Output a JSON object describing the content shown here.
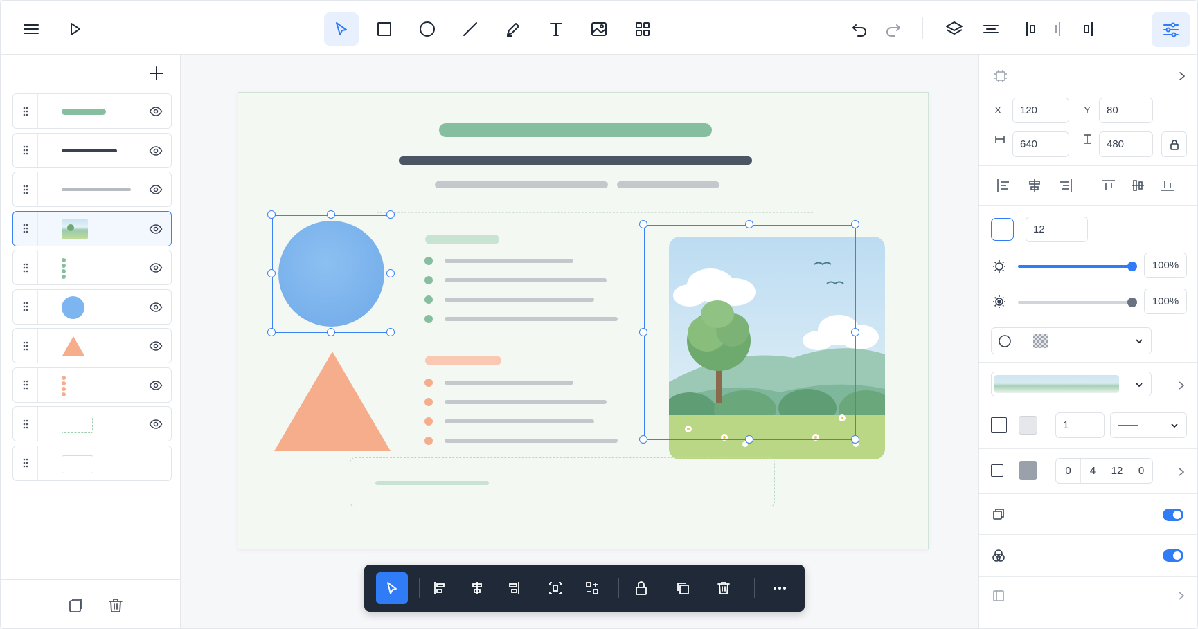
{
  "toolbar": {
    "left_tools": [
      "menu-icon",
      "play-icon"
    ],
    "tools": [
      "select-tool",
      "rectangle-tool",
      "ellipse-tool",
      "line-tool",
      "pen-tool",
      "text-tool",
      "image-tool",
      "components-tool"
    ],
    "active_tool": "select-tool",
    "right_tools": [
      "undo",
      "redo",
      "layers",
      "distribute",
      "align-left-edge",
      "align-center-v",
      "align-right-edge",
      "properties"
    ]
  },
  "layers": [
    {
      "name": "title-bar-green",
      "kind": "bar",
      "color": "#86bfa0",
      "visible": true
    },
    {
      "name": "heading-bar-dark",
      "kind": "bar",
      "color": "#374151",
      "visible": true
    },
    {
      "name": "subtitle-bar-gray",
      "kind": "bar",
      "color": "#b8bcc2",
      "visible": true
    },
    {
      "name": "landscape-image",
      "kind": "image",
      "visible": true,
      "selected": true
    },
    {
      "name": "green-bullet-list",
      "kind": "dots",
      "color": "#86bfa0",
      "visible": true
    },
    {
      "name": "blue-circle",
      "kind": "circle",
      "color": "#7cb5ef",
      "visible": true
    },
    {
      "name": "orange-triangle",
      "kind": "triangle",
      "color": "#f6ad8c",
      "visible": true
    },
    {
      "name": "orange-bullet-list",
      "kind": "dots",
      "color": "#f6ad8c",
      "visible": true
    },
    {
      "name": "dashed-container",
      "kind": "dashed-rect",
      "visible": true
    },
    {
      "name": "empty-rect",
      "kind": "rect",
      "visible": false
    }
  ],
  "colors": {
    "accent": "#2f7cf6",
    "green": "#86bfa0",
    "green_light": "#c9e3d2",
    "dark": "#4b5563",
    "gray": "#c4c7cc",
    "orange": "#f6ad8c",
    "orange_light": "#f9c9b3",
    "blue_shape": "#7cb5ef"
  },
  "properties": {
    "x_label": "X",
    "x_value": "120",
    "y_label": "Y",
    "y_value": "80",
    "w_value": "640",
    "h_value": "480",
    "radius_value": "12",
    "opacity_value": "100%",
    "blur_value": "100%",
    "opacity_level": 1.0,
    "blur_level": 1.0,
    "stroke_width": "1",
    "shadow_values": [
      "0",
      "4",
      "12",
      "0"
    ],
    "toggle_clip": true,
    "toggle_blend": true
  }
}
